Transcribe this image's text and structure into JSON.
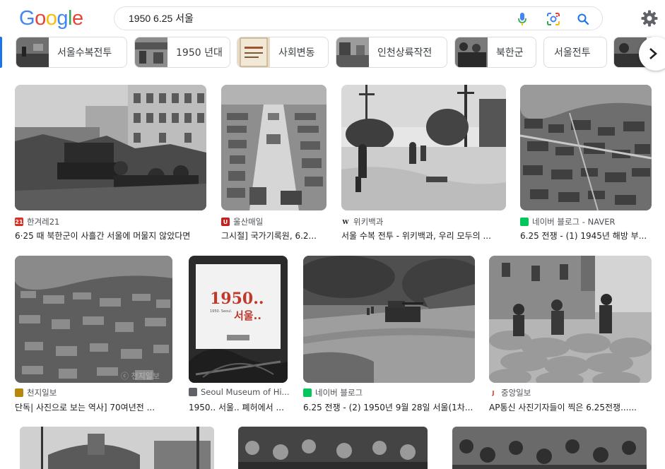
{
  "header": {
    "logo_letters": [
      "G",
      "o",
      "o",
      "g",
      "l",
      "e"
    ],
    "logo_colors": [
      "#4285F4",
      "#EA4335",
      "#FBBC05",
      "#4285F4",
      "#34A853",
      "#EA4335"
    ],
    "search_query": "1950 6.25 서울",
    "icons": [
      "mic-icon",
      "lens-icon",
      "search-icon",
      "gear-icon"
    ]
  },
  "chips": [
    {
      "label": "서울수복전투"
    },
    {
      "label": "1950 년대"
    },
    {
      "label": "사회변동"
    },
    {
      "label": "인천상륙작전"
    },
    {
      "label": "북한군"
    },
    {
      "label": "서울전투"
    }
  ],
  "results": [
    {
      "source": "한겨레21",
      "title": "6·25 때 북한군이 사흘간 서울에 머물지 않았다면",
      "fav_color": "#d93025",
      "fav_text": "21"
    },
    {
      "source": "울산매일",
      "title": "그시절] 국가기록원, 6.2...",
      "fav_color": "#c5221f",
      "fav_text": "U"
    },
    {
      "source": "위키백과",
      "title": "서울 수복 전투 - 위키백과, 우리 모두의 ...",
      "fav_color": "#ffffff",
      "fav_text": "W"
    },
    {
      "source": "네이버 블로그 - NAVER",
      "title": "6.25 전쟁 - (1) 1945년 해방 부...",
      "fav_color": "#03c75a",
      "fav_text": ""
    },
    {
      "source": "천지일보",
      "title": "단독| 사진으로 보는 역사] 70여년전 ...",
      "fav_color": "#b8860b",
      "fav_text": ""
    },
    {
      "source": "Seoul Museum of Hi...",
      "title": "1950.. 서울.. 폐허에서 ...",
      "fav_color": "#5f6368",
      "fav_text": ""
    },
    {
      "source": "네이버 블로그",
      "title": "6.25 전쟁 - (2) 1950년 9월 28일 서울(1차...",
      "fav_color": "#03c75a",
      "fav_text": ""
    },
    {
      "source": "중앙일보",
      "title": "AP통신 사진기자들이 찍은 6.25전쟁......",
      "fav_color": "#ffffff",
      "fav_text": "J"
    }
  ],
  "poster": {
    "big": "1950..",
    "line2": "서울..",
    "small": "1950. Seoul."
  }
}
